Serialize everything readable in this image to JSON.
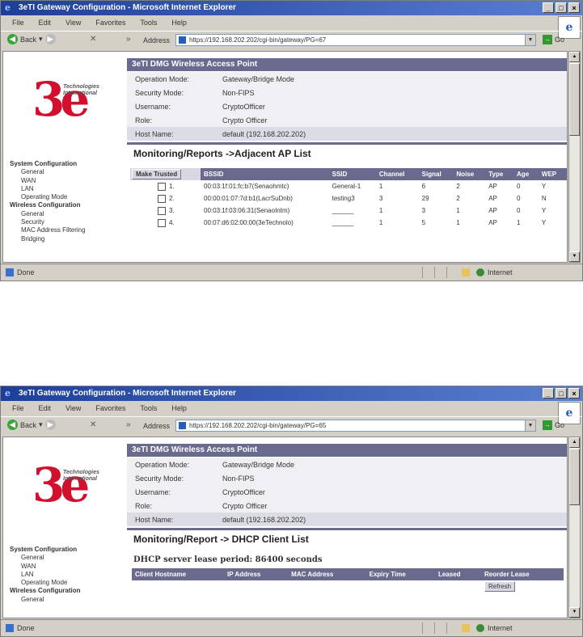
{
  "browser": {
    "title": "3eTI Gateway Configuration - Microsoft Internet Explorer",
    "menu": [
      "File",
      "Edit",
      "View",
      "Favorites",
      "Tools",
      "Help"
    ],
    "back_label": "Back",
    "address_label": "Address",
    "go_label": "Go",
    "status_done": "Done",
    "status_zone": "Internet"
  },
  "screens": [
    {
      "url": "https://192.168.202.202/cgi-bin/gateway/PG=67",
      "sidebar": [
        {
          "label": "System Configuration",
          "level": "group"
        },
        {
          "label": "General",
          "level": "sub"
        },
        {
          "label": "WAN",
          "level": "sub"
        },
        {
          "label": "LAN",
          "level": "sub"
        },
        {
          "label": "Operating Mode",
          "level": "sub"
        },
        {
          "label": "Wireless Configuration",
          "level": "group"
        },
        {
          "label": "General",
          "level": "sub"
        },
        {
          "label": "Security",
          "level": "sub"
        },
        {
          "label": "MAC Address Filtering",
          "level": "sub"
        },
        {
          "label": "Bridging",
          "level": "sub"
        }
      ],
      "section_title": "Monitoring/Reports ->Adjacent AP List",
      "ap_button": "Make Trusted",
      "ap_columns": [
        "BSSID",
        "SSID",
        "Channel",
        "Signal",
        "Noise",
        "Type",
        "Age",
        "WEP"
      ],
      "ap_rows": [
        {
          "n": "1.",
          "bssid": "00:03:1f:01:fc:b7(Senaohmtc)",
          "ssid": "General-1",
          "channel": "1",
          "signal": "6",
          "noise": "2",
          "type": "AP",
          "age": "0",
          "wep": "Y"
        },
        {
          "n": "2.",
          "bssid": "00:00:01:07:7d:b1(LacrSuDnb)",
          "ssid": "testing3",
          "channel": "3",
          "signal": "29",
          "noise": "2",
          "type": "AP",
          "age": "0",
          "wep": "N"
        },
        {
          "n": "3.",
          "bssid": "00:03:1f:03:06:31(SenaoIntm)",
          "ssid": "______",
          "channel": "1",
          "signal": "3",
          "noise": "1",
          "type": "AP",
          "age": "0",
          "wep": "Y"
        },
        {
          "n": "4.",
          "bssid": "00:07:d6:02:00:00(3eTechnolo)",
          "ssid": "______",
          "channel": "1",
          "signal": "5",
          "noise": "1",
          "type": "AP",
          "age": "1",
          "wep": "Y"
        }
      ]
    },
    {
      "url": "https://192.168.202.202/cgi-bin/gateway/PG=65",
      "sidebar": [
        {
          "label": "System Configuration",
          "level": "group"
        },
        {
          "label": "General",
          "level": "sub"
        },
        {
          "label": "WAN",
          "level": "sub"
        },
        {
          "label": "LAN",
          "level": "sub"
        },
        {
          "label": "Operating Mode",
          "level": "sub"
        },
        {
          "label": "Wireless Configuration",
          "level": "group"
        },
        {
          "label": "General",
          "level": "sub"
        }
      ],
      "section_title": "Monitoring/Report -> DHCP Client List",
      "lease_text": "DHCP server lease period: 86400 seconds",
      "dhcp_columns": [
        "Client Hostname",
        "IP Address",
        "MAC Address",
        "Expiry Time",
        "Leased",
        "Reorder Lease"
      ],
      "refresh_button": "Refresh"
    }
  ],
  "header": {
    "title": "3eTI DMG Wireless Access Point",
    "info": [
      {
        "key": "Operation Mode:",
        "value": "Gateway/Bridge Mode"
      },
      {
        "key": "Security Mode:",
        "value": "Non-FIPS"
      },
      {
        "key": "Username:",
        "value": "CryptoOfficer"
      },
      {
        "key": "Role:",
        "value": "Crypto Officer"
      },
      {
        "key": "Host Name:",
        "value": "default (192.168.202.202)"
      }
    ]
  },
  "logo": {
    "mark": "3e",
    "line1": "Technologies",
    "line2": "International"
  }
}
